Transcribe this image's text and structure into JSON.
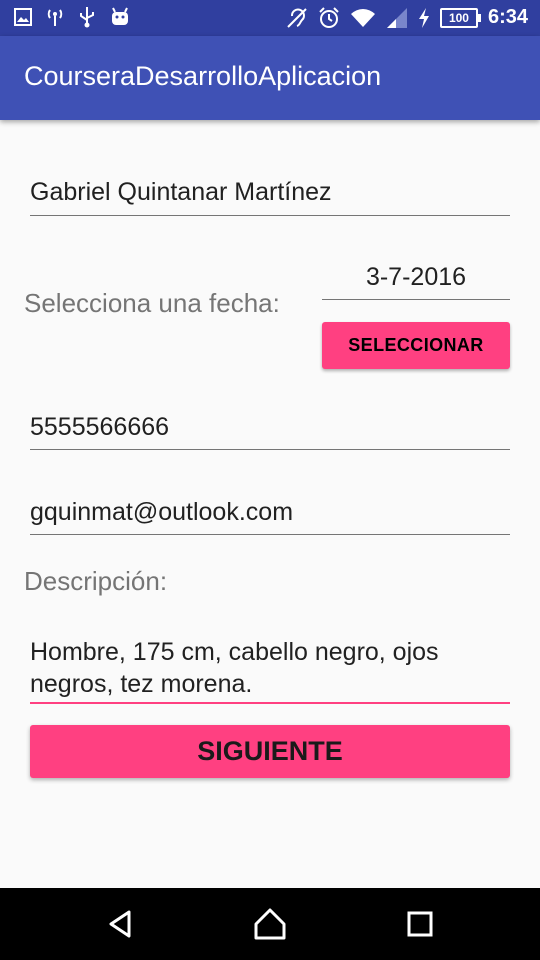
{
  "statusbar": {
    "time": "6:34",
    "battery": "100"
  },
  "appbar": {
    "title": "CourseraDesarrolloAplicacion"
  },
  "form": {
    "name_value": "Gabriel Quintanar Martínez",
    "date_label": "Selecciona una fecha:",
    "date_value": "3-7-2016",
    "select_button": "SELECCIONAR",
    "phone_value": "5555566666",
    "email_value": "gquinmat@outlook.com",
    "description_label": "Descripción:",
    "description_value": "Hombre, 175 cm, cabello negro, ojos negros, tez morena.",
    "next_button": "SIGUIENTE"
  },
  "colors": {
    "primary": "#3f51b5",
    "primary_dark": "#303f9f",
    "accent": "#ff4081"
  }
}
